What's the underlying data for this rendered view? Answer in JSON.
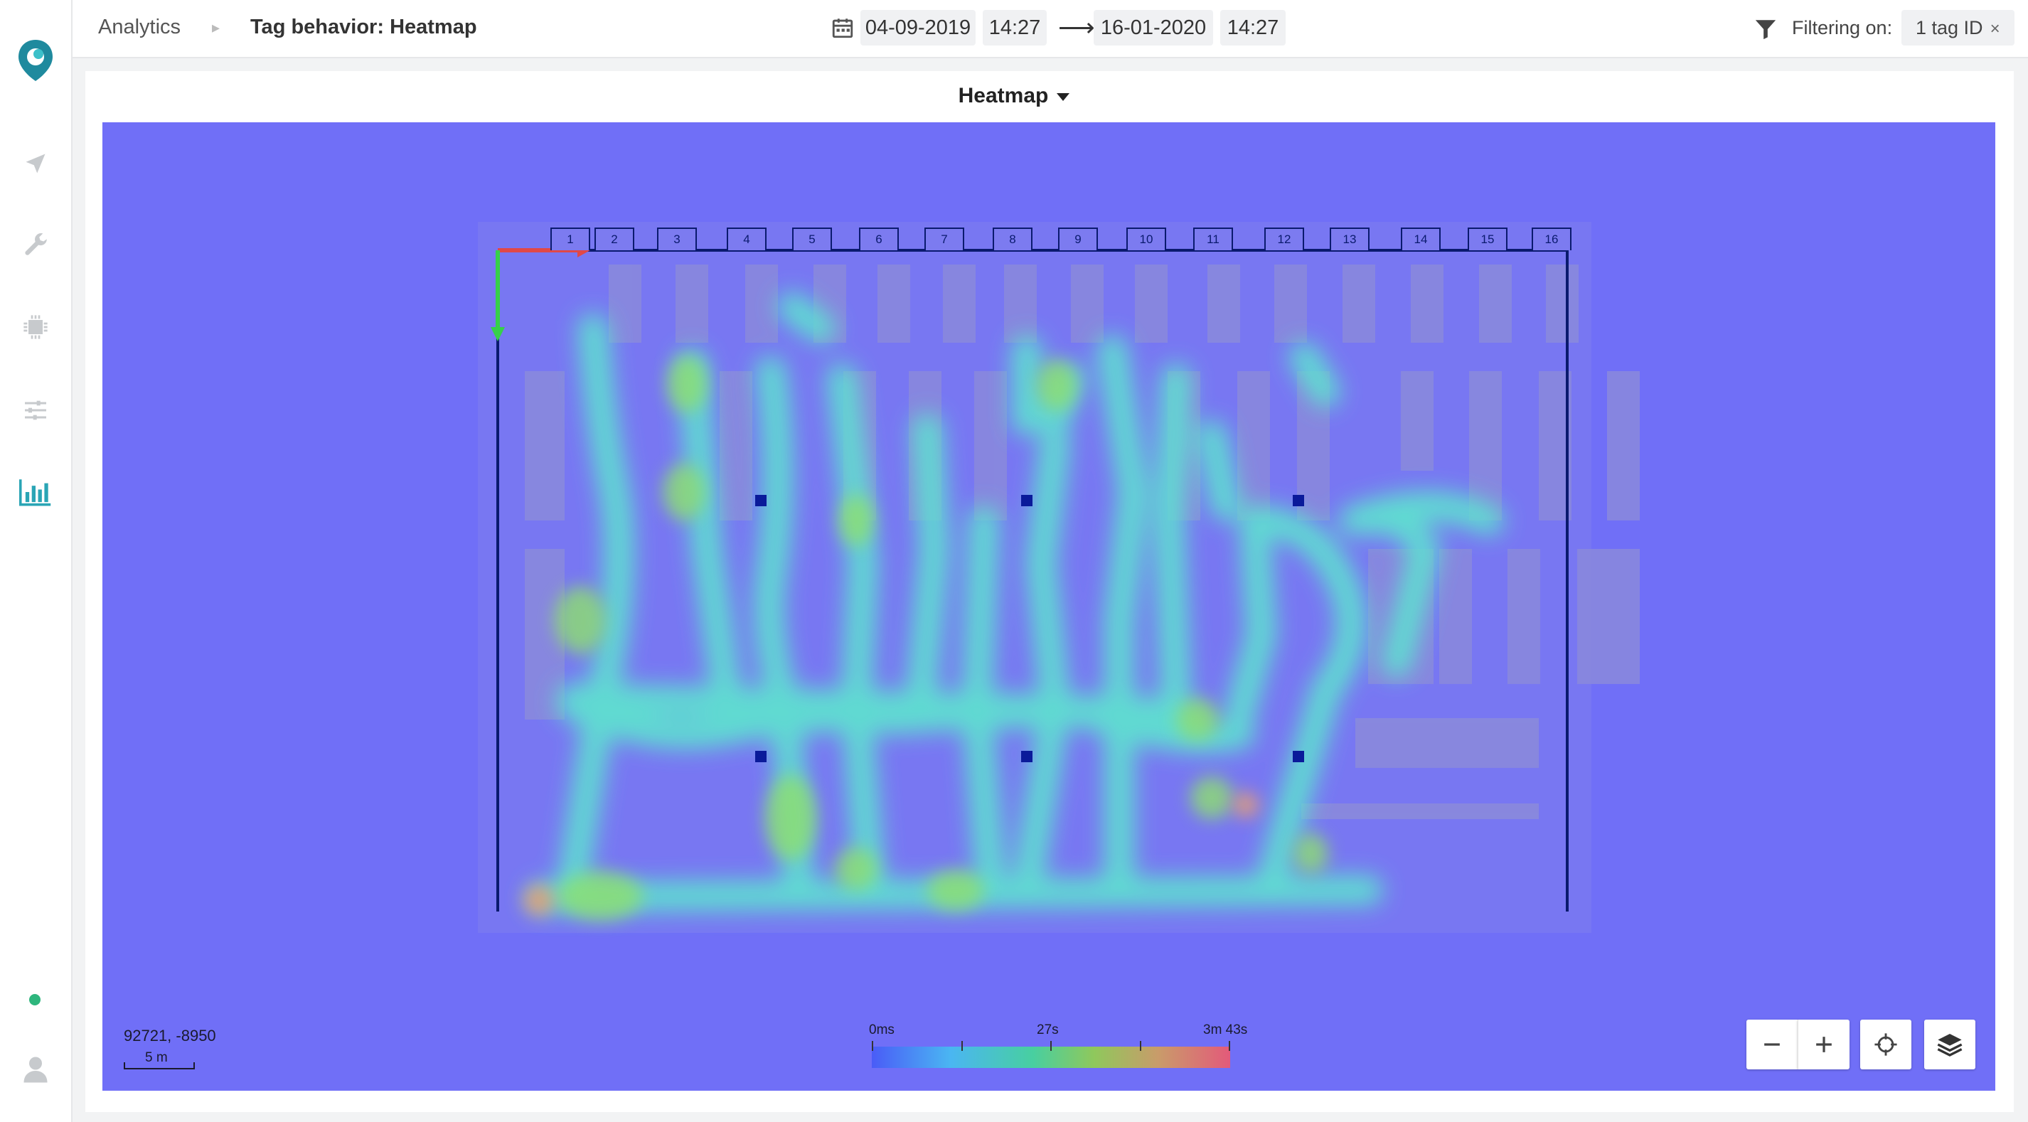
{
  "breadcrumb": {
    "section": "Analytics",
    "page": "Tag behavior",
    "separator": ":",
    "view": "Heatmap"
  },
  "date_range": {
    "start_date": "04-09-2019",
    "start_time": "14:27",
    "end_date": "16-01-2020",
    "end_time": "14:27"
  },
  "filter": {
    "label": "Filtering on:",
    "chip_label": "1 tag ID",
    "remove_glyph": "×"
  },
  "panel": {
    "title": "Heatmap"
  },
  "map": {
    "cursor_coordinates": "92721, -8950",
    "scale_label": "5 m",
    "rack_labels": [
      "1",
      "2",
      "3",
      "4",
      "5",
      "6",
      "7",
      "8",
      "9",
      "10",
      "11",
      "12",
      "13",
      "14",
      "15",
      "16"
    ],
    "legend": {
      "min_label": "0ms",
      "mid_label": "27s",
      "max_label": "3m 43s"
    }
  },
  "sidebar": {
    "icons": [
      "logo-icon",
      "navigate-icon",
      "wrench-icon",
      "chip-icon",
      "sliders-icon",
      "chart-icon",
      "status-dot",
      "user-icon"
    ],
    "active": "chart-icon"
  },
  "colors": {
    "accent": "#2aa5b5",
    "map_background": "#706ff7",
    "status_online": "#2eb67d"
  }
}
